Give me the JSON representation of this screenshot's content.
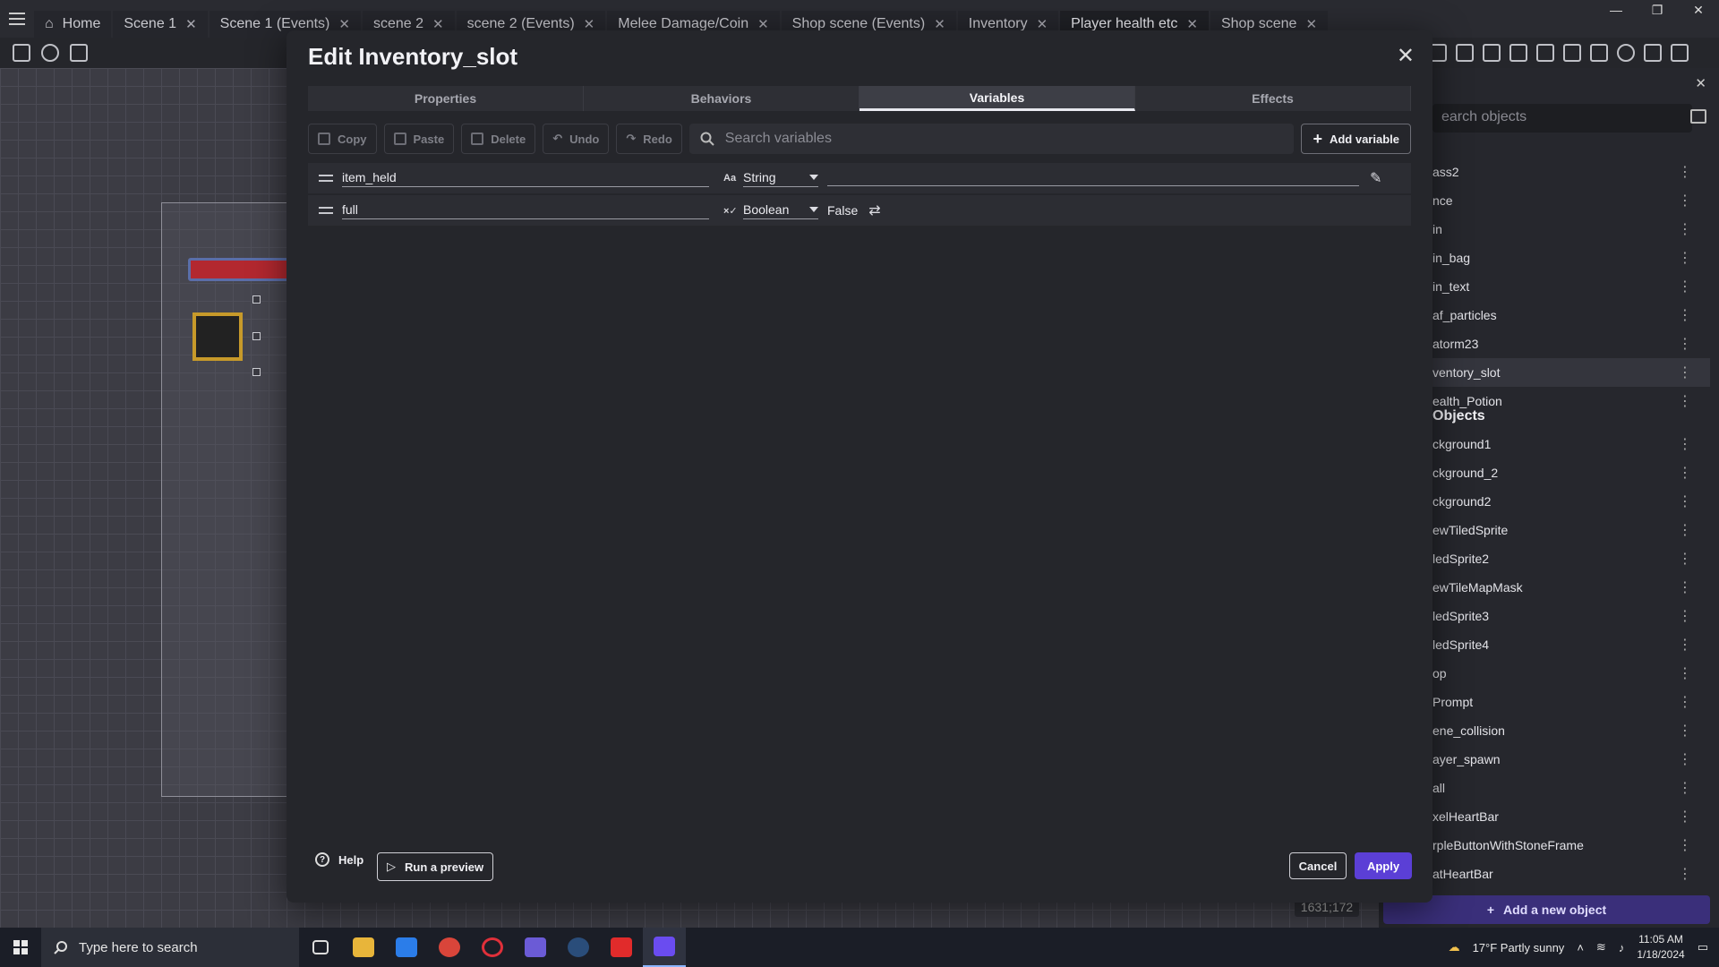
{
  "top_tabs": [
    {
      "label": "Home",
      "closable": false
    },
    {
      "label": "Scene 1",
      "closable": true
    },
    {
      "label": "Scene 1 (Events)",
      "closable": true
    },
    {
      "label": "scene 2",
      "closable": true
    },
    {
      "label": "scene 2 (Events)",
      "closable": true
    },
    {
      "label": "Melee Damage/Coin",
      "closable": true
    },
    {
      "label": "Shop scene (Events)",
      "closable": true
    },
    {
      "label": "Inventory",
      "closable": true
    },
    {
      "label": "Player health etc",
      "closable": true,
      "active": true
    },
    {
      "label": "Shop scene",
      "closable": true
    }
  ],
  "canvas": {
    "coords": "1631;172"
  },
  "objects_panel": {
    "search_placeholder": "earch objects",
    "items": [
      "ass2",
      "nce",
      "in",
      "in_bag",
      "in_text",
      "af_particles",
      "atorm23",
      "ventory_slot",
      "ealth_Potion"
    ],
    "selected_index": 7,
    "group_label": "Objects",
    "group_items": [
      "ckground1",
      "ckground_2",
      "ckground2",
      "ewTiledSprite",
      "ledSprite2",
      "ewTileMapMask",
      "ledSprite3",
      "ledSprite4",
      "op",
      "Prompt",
      "ene_collision",
      "ayer_spawn",
      "all",
      "xelHeartBar",
      "rpleButtonWithStoneFrame",
      "atHeartBar"
    ],
    "add_label": "Add a new object"
  },
  "dialog": {
    "title": "Edit Inventory_slot",
    "tabs": [
      "Properties",
      "Behaviors",
      "Variables",
      "Effects"
    ],
    "active_tab": "Variables",
    "toolbar": {
      "copy": "Copy",
      "paste": "Paste",
      "delete": "Delete",
      "undo": "Undo",
      "redo": "Redo",
      "search_placeholder": "Search variables",
      "add_variable": "Add variable"
    },
    "variables": [
      {
        "name": "item_held",
        "type_icon": "Aa",
        "type": "String",
        "value": ""
      },
      {
        "name": "full",
        "type_icon": "×✓",
        "type": "Boolean",
        "value": "False"
      }
    ],
    "footer": {
      "help": "Help",
      "run_preview": "Run a preview",
      "cancel": "Cancel",
      "apply": "Apply"
    }
  },
  "taskbar": {
    "search_placeholder": "Type here to search",
    "weather": "17°F  Partly sunny",
    "time": "11:05 AM",
    "date": "1/18/2024"
  },
  "colors": {
    "accent": "#5b3fd6",
    "health_bar": "#b3282f",
    "slot_border": "#c79a2a"
  }
}
